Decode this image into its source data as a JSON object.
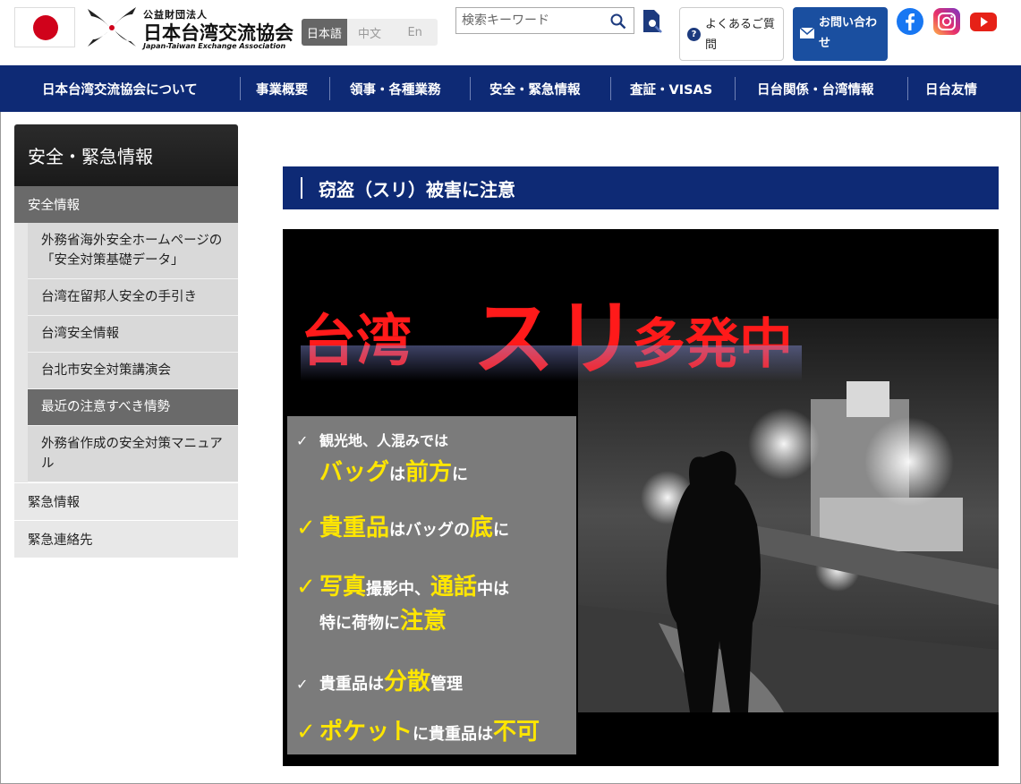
{
  "header": {
    "logo": {
      "sub": "公益財団法人",
      "main": "日本台湾交流協会",
      "en": "Japan-Taiwan Exchange Association"
    },
    "languages": [
      {
        "label": "日本語",
        "active": true
      },
      {
        "label": "中文",
        "active": false
      },
      {
        "label": "En",
        "active": false
      }
    ],
    "search": {
      "placeholder": "検索キーワード"
    },
    "faq_label": "よくあるご質問",
    "contact_label": "お問い合わせ",
    "icons": {
      "faq": "question-circle-icon",
      "contact": "envelope-icon",
      "search": "magnifier-icon",
      "advanced_search": "document-search-icon",
      "facebook": "facebook-icon",
      "instagram": "instagram-icon",
      "youtube": "youtube-icon"
    }
  },
  "nav": {
    "items": [
      "日本台湾交流協会について",
      "事業概要",
      "領事・各種業務",
      "安全・緊急情報",
      "査証・VISAS",
      "日台関係・台湾情報",
      "日台友情"
    ]
  },
  "sidebar": {
    "title": "安全・緊急情報",
    "active_section": "安全情報",
    "sub_items": [
      {
        "label": "外務省海外安全ホームページの「安全対策基礎データ」",
        "current": false
      },
      {
        "label": "台湾在留邦人安全の手引き",
        "current": false
      },
      {
        "label": "台湾安全情報",
        "current": false
      },
      {
        "label": "台北市安全対策講演会",
        "current": false
      },
      {
        "label": "最近の注意すべき情勢",
        "current": true
      },
      {
        "label": "外務省作成の安全対策マニュアル",
        "current": false
      }
    ],
    "items": [
      "緊急情報",
      "緊急連絡先"
    ]
  },
  "main": {
    "title": "窃盗（スリ）被害に注意",
    "poster": {
      "headline": {
        "a": "台湾",
        "b": "スリ",
        "c": "多発中"
      },
      "tips": {
        "t1": {
          "line1": "観光地、人混みでは",
          "y1": "バッグ",
          "m1": "は",
          "y2": "前方",
          "m2": "に"
        },
        "t2": {
          "y1": "貴重品",
          "m1": "はバッグの",
          "y2": "底",
          "m2": "に"
        },
        "t3": {
          "y1": "写真",
          "m1": "撮影中、",
          "y2": "通話",
          "m2": "中は",
          "line2a": "特に荷物に",
          "line2b": "注意"
        },
        "t4": {
          "m1": "貴重品は",
          "y1": "分散",
          "m2": "管理"
        },
        "t5": {
          "y1": "ポケット",
          "m1": "に貴重品は",
          "y2": "不可"
        },
        "check": "✓"
      },
      "colors": {
        "headline": "#ff1a1a",
        "highlight": "#ffe600",
        "panel": "#7b7b7b"
      }
    }
  },
  "colors": {
    "nav": "#0e2a75",
    "contact": "#1a4fa0",
    "flag_sun": "#d0021b"
  }
}
